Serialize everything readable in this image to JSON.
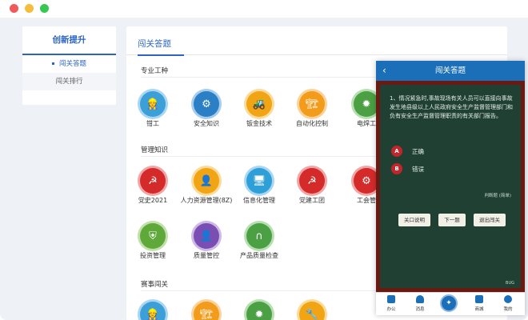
{
  "sidebar": {
    "title": "创新提升",
    "items": [
      {
        "label": "闯关答题"
      },
      {
        "label": "闯关排行"
      }
    ]
  },
  "main": {
    "title": "闯关答题",
    "sections": [
      {
        "title": "专业工种",
        "tiles": [
          {
            "label": "钳工",
            "icon": "worker-icon",
            "color": "#3d9fd8",
            "ring": "#a9d6f2"
          },
          {
            "label": "安全知识",
            "icon": "shield-gear-icon",
            "color": "#2b7fc4",
            "ring": "#a7cdec"
          },
          {
            "label": "钣金技术",
            "icon": "forklift-icon",
            "color": "#f2a514",
            "ring": "#fbdb99"
          },
          {
            "label": "自动化控制",
            "icon": "crane-icon",
            "color": "#f39c1b",
            "ring": "#fad39a"
          },
          {
            "label": "电焊工",
            "icon": "spark-icon",
            "color": "#4aa043",
            "ring": "#b7dfb1"
          }
        ]
      },
      {
        "title": "管理知识",
        "tiles": [
          {
            "label": "党史2021",
            "icon": "party-emblem-icon",
            "color": "#d42a2a",
            "ring": "#f1a6a6"
          },
          {
            "label": "人力资源管理(8Z)",
            "icon": "manager-icon",
            "color": "#f2a514",
            "ring": "#fbdb99"
          },
          {
            "label": "信息化管理",
            "icon": "monitor-icon",
            "color": "#2f9fd8",
            "ring": "#a9d6f2"
          },
          {
            "label": "党建工团",
            "icon": "party-emblem-icon",
            "color": "#d42a2a",
            "ring": "#f1a6a6"
          },
          {
            "label": "工会管",
            "icon": "union-icon",
            "color": "#d42a2a",
            "ring": "#f1a6a6"
          },
          {
            "label": "投资管理",
            "icon": "shield-icon",
            "color": "#5fa83a",
            "ring": "#c2e0a9"
          },
          {
            "label": "质量管控",
            "icon": "user-check-icon",
            "color": "#7a4fb3",
            "ring": "#cdb8e6"
          },
          {
            "label": "产品质量检查",
            "icon": "magnet-icon",
            "color": "#4aa043",
            "ring": "#b7dfb1"
          }
        ]
      },
      {
        "title": "赛事闯关",
        "tiles": [
          {
            "label": "",
            "icon": "worker-icon",
            "color": "#3d9fd8",
            "ring": "#a9d6f2"
          },
          {
            "label": "",
            "icon": "crane-icon",
            "color": "#f39c1b",
            "ring": "#fad39a"
          },
          {
            "label": "",
            "icon": "spark-icon",
            "color": "#4aa043",
            "ring": "#b7dfb1"
          },
          {
            "label": "",
            "icon": "wrench-icon",
            "color": "#f2a514",
            "ring": "#fbdb99"
          }
        ]
      }
    ]
  },
  "phone": {
    "title": "闯关答题",
    "back_icon": "chevron-left-icon",
    "question": "1、情况紧急时,事故现场有关人员可以直接向事故发生地县级以上人民政府安全生产监督管理部门和负有安全生产监督管理职责的有关部门报告。",
    "options": [
      {
        "key": "A",
        "text": "正确"
      },
      {
        "key": "B",
        "text": "错误"
      }
    ],
    "question_type": "判断题 (简单)",
    "buttons": [
      "关口说明",
      "下一题",
      "退出闯关"
    ],
    "brand": "BUG",
    "tabs": [
      {
        "label": "办公",
        "icon": "office-icon"
      },
      {
        "label": "消息",
        "icon": "bell-icon"
      },
      {
        "label": "",
        "icon": "emblem-icon"
      },
      {
        "label": "商城",
        "icon": "store-icon"
      },
      {
        "label": "我的",
        "icon": "user-icon"
      }
    ]
  }
}
